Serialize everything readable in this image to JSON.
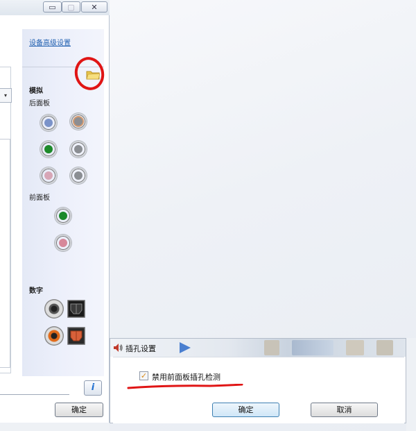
{
  "main_window": {
    "minimize_glyph": "▭",
    "maximize_glyph": "▢",
    "close_glyph": "✕",
    "dropdown_arrow": "▾",
    "advanced_link": "设备高级设置",
    "analog_label": "模拟",
    "rear_panel_label": "后面板",
    "front_panel_label": "前面板",
    "digital_label": "数字",
    "info_glyph": "i",
    "ok_label": "确定"
  },
  "jack_dialog": {
    "title": "插孔设置",
    "checkbox_label": "禁用前面板插孔检测",
    "checkbox_checked": true,
    "check_glyph": "✓",
    "ok_label": "确定",
    "cancel_label": "取消"
  },
  "colors": {
    "annotation_red": "#e01515",
    "link_blue": "#1f5fb0",
    "jack_blue": "#7b93c9",
    "jack_orange": "#d39a70",
    "jack_green": "#1d8a2a",
    "jack_grey": "#8b8e93",
    "jack_pink": "#d7a6b6",
    "front_green": "#1a8a2a",
    "front_pink": "#d7889a",
    "coax_orange": "#e06a1a",
    "optical_orange": "#d8603a"
  }
}
